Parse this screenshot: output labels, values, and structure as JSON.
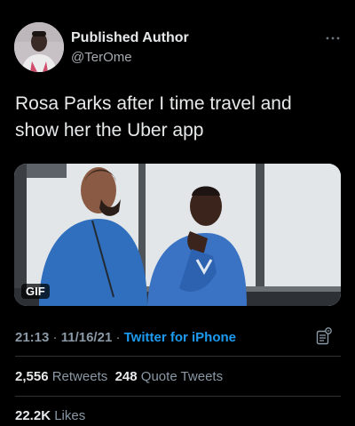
{
  "author": {
    "name": "Published Author",
    "handle": "@TerOme"
  },
  "tweet": {
    "text": "Rosa Parks after I time travel and show her the Uber app"
  },
  "media": {
    "badge": "GIF"
  },
  "meta": {
    "time": "21:13",
    "date": "11/16/21",
    "source": "Twitter for iPhone",
    "sep1": " · ",
    "sep2": " · "
  },
  "stats": {
    "retweets_count": "2,556",
    "retweets_label": "Retweets",
    "quotes_count": "248",
    "quotes_label": "Quote Tweets",
    "likes_count": "22.2K",
    "likes_label": "Likes"
  },
  "icons": {
    "more": "more-icon",
    "analytics": "analytics-icon"
  },
  "colors": {
    "background": "#000000",
    "text": "#e7e9ea",
    "secondary": "#8b98a5",
    "link": "#1d9bf0",
    "divider": "#2f3336"
  }
}
